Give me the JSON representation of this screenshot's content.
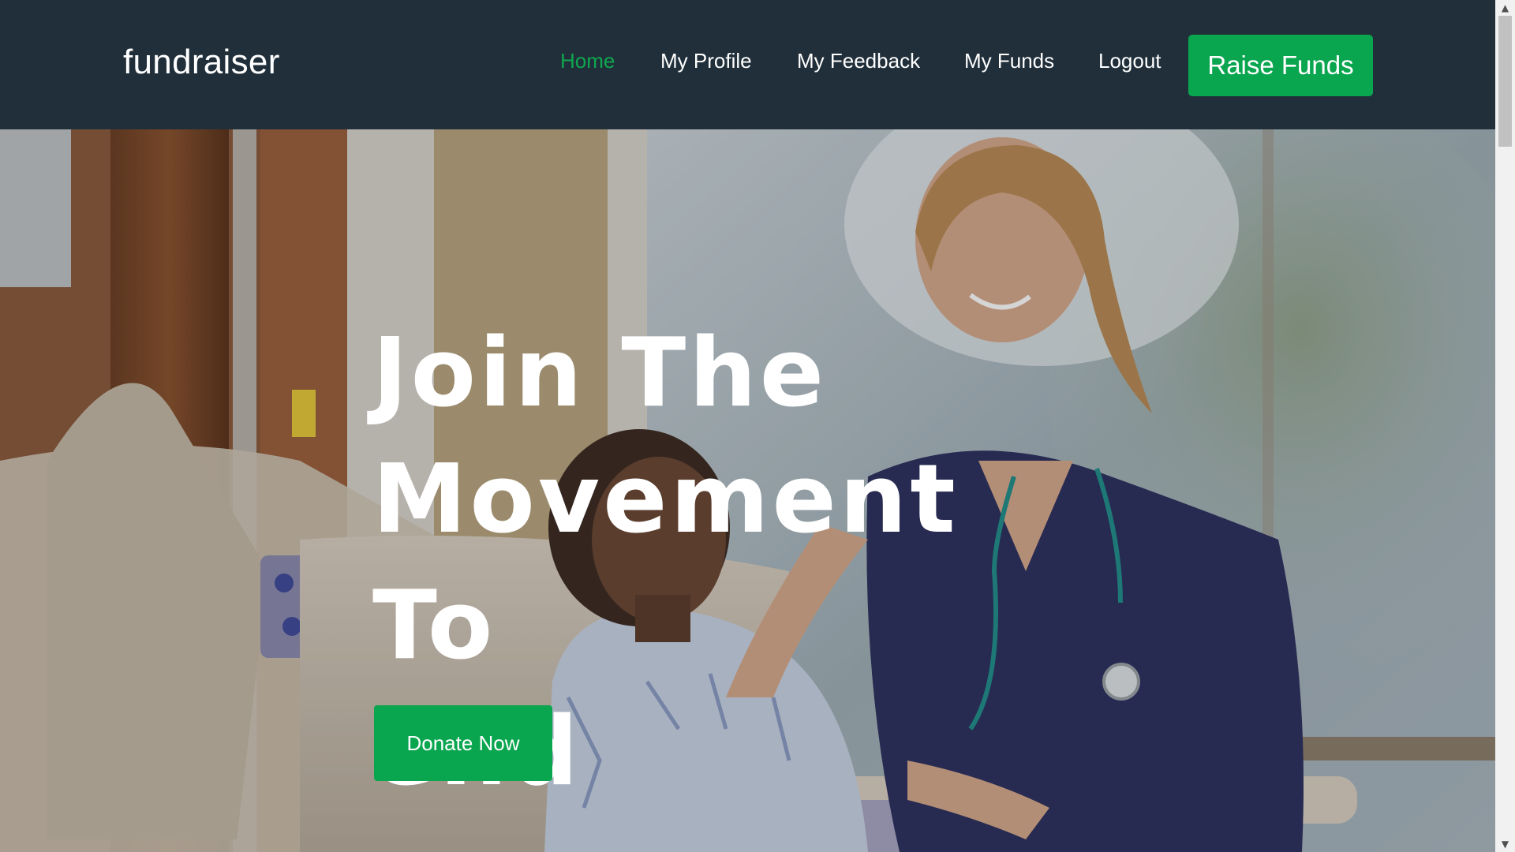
{
  "header": {
    "brand": "fundraiser",
    "nav": [
      {
        "label": "Home",
        "active": true
      },
      {
        "label": "My Profile",
        "active": false
      },
      {
        "label": "My Feedback",
        "active": false
      },
      {
        "label": "My Funds",
        "active": false
      },
      {
        "label": "Logout",
        "active": false
      }
    ],
    "cta_label": "Raise Funds"
  },
  "hero": {
    "title_lines": [
      "Join The",
      "Movement To",
      "end"
    ],
    "button_label": "Donate Now"
  },
  "colors": {
    "navbar_bg": "#202f3a",
    "accent_green": "#0aa64f",
    "active_link": "#10a74f",
    "text_white": "#ffffff"
  },
  "scrollbar": {
    "up_icon": "triangle-up",
    "down_icon": "triangle-down"
  }
}
